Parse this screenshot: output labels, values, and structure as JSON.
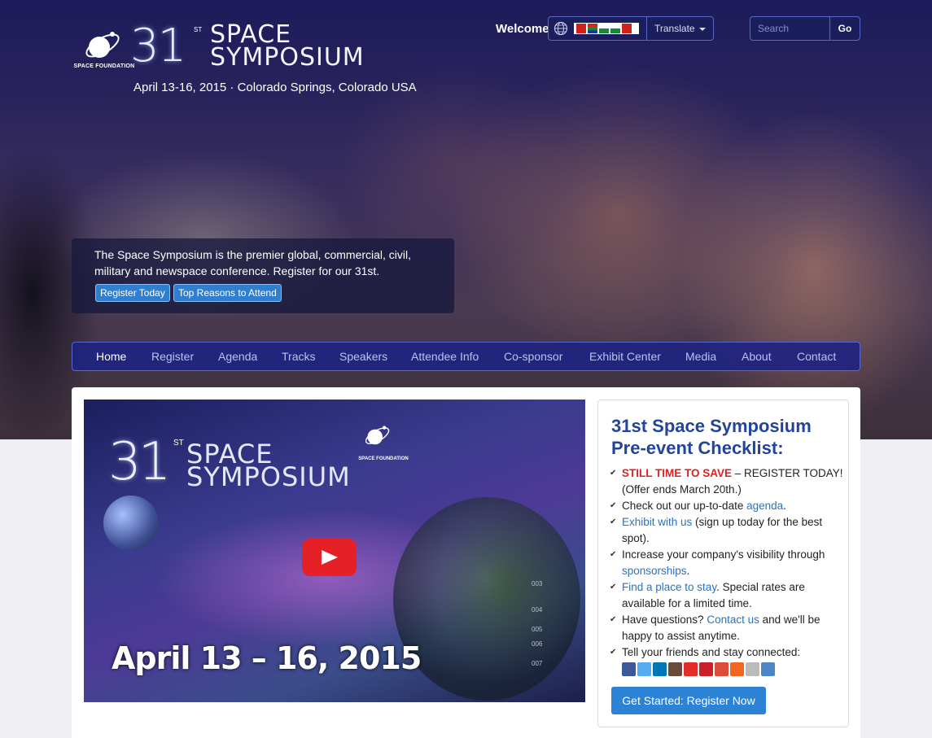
{
  "header": {
    "logo": {
      "number": "31",
      "ordinal": "ST",
      "line1": "SPACE",
      "line2": "SYMPOSIUM",
      "org": "SPACE FOUNDATION"
    },
    "tagline": "April 13-16, 2015 · Colorado Springs, Colorado USA",
    "welcome": "Welcome",
    "translate_label": "Translate",
    "search_placeholder": "Search",
    "search_button": "Go"
  },
  "intro": {
    "text": "The Space Symposium is the premier global, commercial, civil, military and newspace conference. Register for our 31st.",
    "register_button": "Register Today",
    "reasons_button": "Top Reasons to Attend"
  },
  "nav": {
    "items": [
      "Home",
      "Register",
      "Agenda",
      "Tracks",
      "Speakers",
      "Attendee Info",
      "Co-sponsor",
      "Exhibit Center",
      "Media",
      "About",
      "Contact"
    ],
    "active": "Home"
  },
  "video": {
    "number": "31",
    "ordinal": "ST",
    "line1": "SPACE",
    "line2": "SYMPOSIUM",
    "org": "SPACE FOUNDATION",
    "date_text": "April 13 – 16, 2015",
    "codes": [
      "003",
      "004",
      "005",
      "006",
      "007"
    ]
  },
  "checklist": {
    "title": "31st Space Symposium Pre-event Checklist:",
    "items": [
      {
        "highlight": "STILL TIME TO SAVE",
        "text": " – REGISTER TODAY! (Offer ends March 20th.)"
      },
      {
        "pre": "Check out our up-to-date ",
        "link": "agenda",
        "post": "."
      },
      {
        "link": "Exhibit with us",
        "post": " (sign up today for the best spot)."
      },
      {
        "pre": "Increase your company's visibility through ",
        "link": "sponsorships",
        "post": "."
      },
      {
        "link": "Find a place to stay",
        "post": ". Special rates are available for a limited time."
      },
      {
        "pre": "Have questions? ",
        "link": "Contact us",
        "post": " and we'll be happy to assist anytime."
      },
      {
        "pre": "Tell your friends and stay connected:"
      }
    ],
    "social_icons": [
      "facebook-icon",
      "twitter-icon",
      "linkedin-icon",
      "instagram-icon",
      "youtube-icon",
      "pinterest-icon",
      "googleplus-icon",
      "rss-icon",
      "email-icon",
      "flickr-icon"
    ],
    "cta": "Get Started: Register Now"
  },
  "colors": {
    "nav_bg": "#1e2382",
    "title_blue": "#23449c",
    "link_blue": "#2a72c0",
    "highlight_red": "#e02020",
    "cta_blue": "#2c82d4",
    "play_red": "#e52027"
  }
}
